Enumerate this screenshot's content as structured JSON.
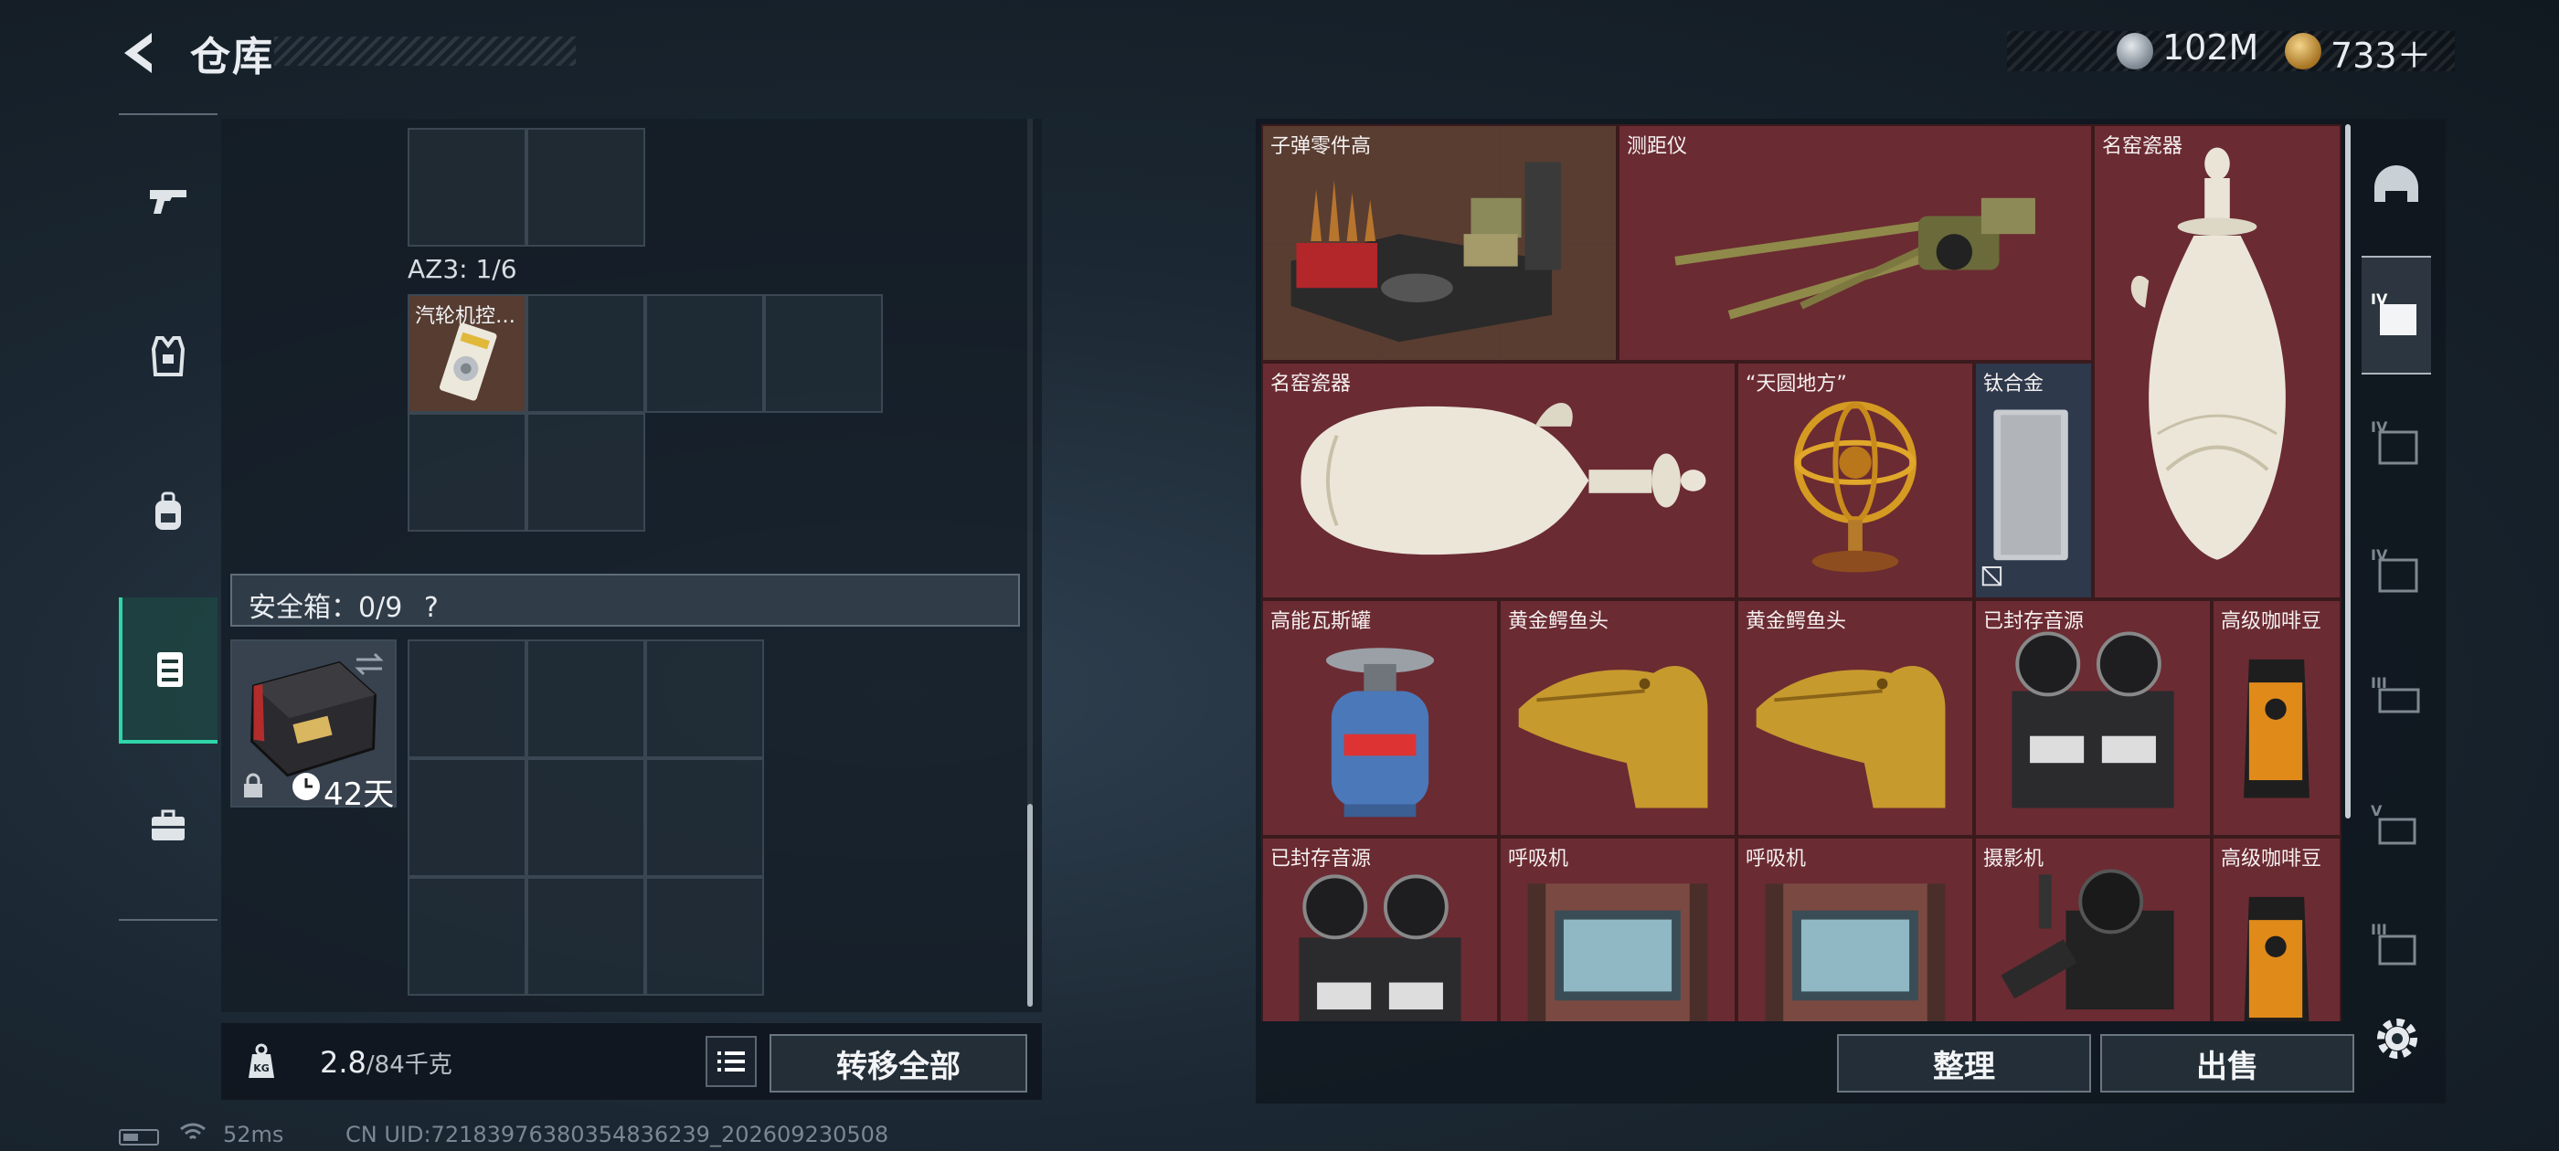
{
  "header": {
    "title": "仓库",
    "currency": [
      {
        "icon": "silver-coin-icon",
        "value": "102M"
      },
      {
        "icon": "gold-coin-icon",
        "value": "733＋"
      }
    ]
  },
  "left_nav": [
    {
      "icon": "pistol-icon",
      "active": false
    },
    {
      "icon": "armor-vest-icon",
      "active": false
    },
    {
      "icon": "backpack-icon",
      "active": false
    },
    {
      "icon": "safe-box-icon",
      "active": true
    },
    {
      "icon": "briefcase-icon",
      "active": false
    }
  ],
  "loadout": {
    "az3_label": "AZ3: 1/6",
    "az3_item": "汽轮机控…",
    "safe_label": "安全箱：0/9",
    "safe_help": "?",
    "safe_box_days": "42天",
    "weight_value": "2.8",
    "weight_max": "/84千克",
    "transfer_all": "转移全部"
  },
  "stash": {
    "items": [
      {
        "name": "子弹零件高"
      },
      {
        "name": "测距仪"
      },
      {
        "name": "名窑瓷器"
      },
      {
        "name": "名窑瓷器"
      },
      {
        "name": "“天圆地方”"
      },
      {
        "name": "钛合金"
      },
      {
        "name": "高能瓦斯罐"
      },
      {
        "name": "黄金鳄鱼头"
      },
      {
        "name": "黄金鳄鱼头"
      },
      {
        "name": "已封存音源"
      },
      {
        "name": "高级咖啡豆"
      },
      {
        "name": "已封存音源"
      },
      {
        "name": "呼吸机"
      },
      {
        "name": "呼吸机"
      },
      {
        "name": "摄影机"
      },
      {
        "name": "高级咖啡豆"
      }
    ],
    "sort_label": "整理",
    "sell_label": "出售"
  },
  "right_nav": [
    {
      "label": "",
      "icon": "helmet-icon"
    },
    {
      "label": "IV",
      "icon": "armor-tier-4-icon"
    },
    {
      "label": "IV",
      "icon": "armor-tier-4-icon"
    },
    {
      "label": "IV",
      "icon": "armor-tier-4-icon"
    },
    {
      "label": "III",
      "icon": "armor-tier-3-icon"
    },
    {
      "label": "V",
      "icon": "armor-tier-5-icon"
    },
    {
      "label": "III",
      "icon": "armor-tier-3-icon"
    }
  ],
  "status_bar": {
    "ping": "52ms",
    "uid": "CN UID:7218397638035483​6239_202609230508"
  }
}
